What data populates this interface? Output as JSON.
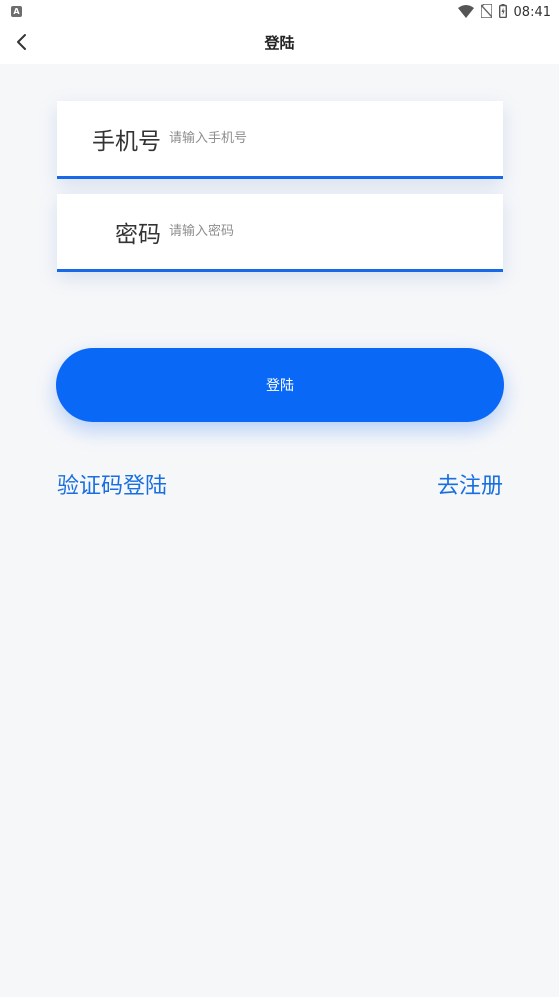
{
  "status_bar": {
    "app_icon_letter": "A",
    "time": "08:41",
    "icons": [
      "wifi-icon",
      "no-sim-icon",
      "battery-icon"
    ]
  },
  "nav": {
    "title": "登陆",
    "back_icon": "chevron-left-icon"
  },
  "form": {
    "phone": {
      "label": "手机号",
      "placeholder": "请输入手机号",
      "value": ""
    },
    "password": {
      "label": "密码",
      "placeholder": "请输入密码",
      "value": ""
    }
  },
  "login_button": {
    "label": "登陆"
  },
  "links": {
    "sms_login": "验证码登陆",
    "register": "去注册"
  },
  "colors": {
    "accent": "#0a68f7",
    "link": "#1a6fe0",
    "underline": "#1769e8",
    "background": "#f6f7f9"
  }
}
